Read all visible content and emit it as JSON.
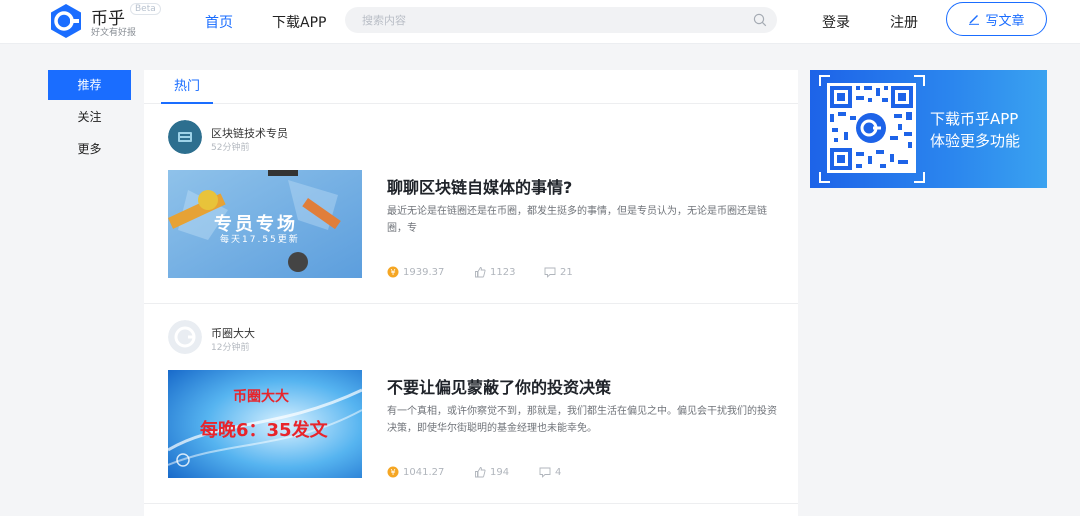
{
  "header": {
    "brand": "币乎",
    "beta": "Beta",
    "slogan": "好文有好报",
    "nav": [
      {
        "label": "首页",
        "active": true
      },
      {
        "label": "下载APP",
        "active": false
      }
    ],
    "search_placeholder": "搜索内容",
    "login": "登录",
    "register": "注册",
    "write": "写文章"
  },
  "sidebar": {
    "items": [
      {
        "label": "推荐",
        "active": true
      },
      {
        "label": "关注",
        "active": false
      },
      {
        "label": "更多",
        "active": false
      }
    ]
  },
  "feed": {
    "tab": "热门",
    "articles": [
      {
        "author": "区块链技术专员",
        "time": "52分钟前",
        "thumb_title": "专员专场",
        "thumb_sub": "每天17.55更新",
        "title": "聊聊区块链自媒体的事情?",
        "summary": "最近无论是在链圈还是在币圈，都发生挺多的事情，但是专员认为，无论是币圈还是链圈，专",
        "coin": "1939.37",
        "likes": "1123",
        "comments": "21"
      },
      {
        "author": "币圈大大",
        "time": "12分钟前",
        "thumb_title": "币圈大大",
        "thumb_sub": "每晚6：35发文",
        "title": "不要让偏见蒙蔽了你的投资决策",
        "summary": "有一个真相，或许你察觉不到，那就是，我们都生活在偏见之中。偏见会干扰我们的投资决策，即使华尔街聪明的基金经理也未能幸免。",
        "coin": "1041.27",
        "likes": "194",
        "comments": "4"
      }
    ]
  },
  "banner": {
    "line1": "下载币乎APP",
    "line2": "体验更多功能"
  },
  "colors": {
    "accent": "#1a6dff",
    "coin": "#f5a623"
  }
}
